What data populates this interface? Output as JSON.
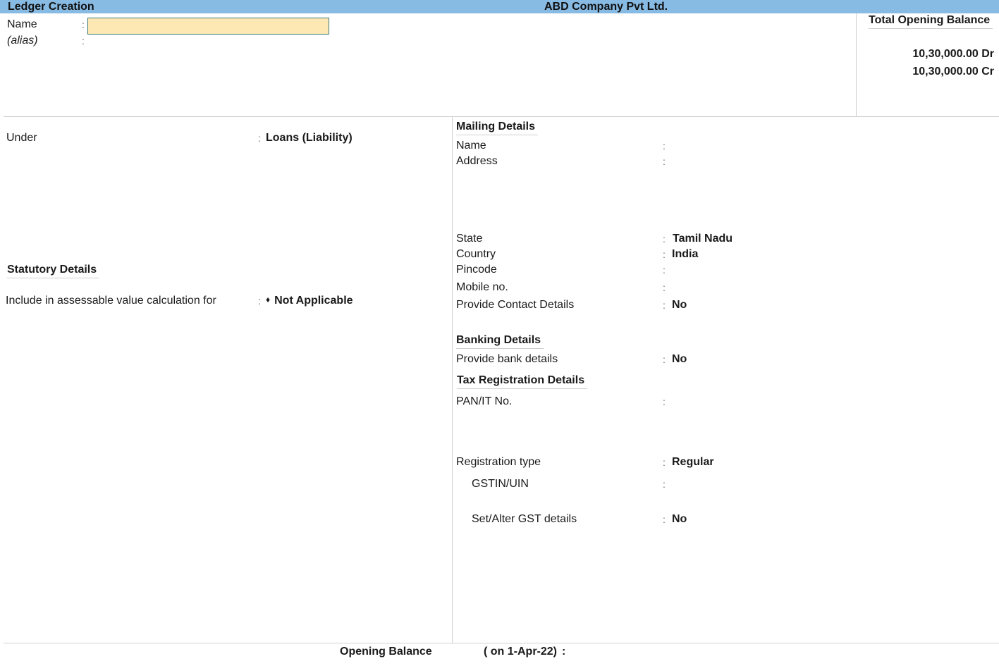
{
  "header": {
    "screen_title": "Ledger Creation",
    "company_name": "ABD Company Pvt Ltd."
  },
  "top": {
    "name_label": "Name",
    "name_value": "",
    "alias_label": "(alias)",
    "alias_value": ""
  },
  "total_opening_balance": {
    "title": "Total Opening Balance",
    "debit": "10,30,000.00 Dr",
    "credit": "10,30,000.00 Cr"
  },
  "left": {
    "under_label": "Under",
    "under_value": "Loans (Liability)",
    "statutory_heading": "Statutory Details",
    "assessable_label": "Include in assessable value calculation for",
    "assessable_value": "Not Applicable",
    "assessable_icon": "diamond-icon"
  },
  "mailing": {
    "heading": "Mailing Details",
    "fields": [
      {
        "label": "Name",
        "value": ""
      },
      {
        "label": "Address",
        "value": ""
      },
      {
        "label": "State",
        "value": "Tamil Nadu"
      },
      {
        "label": "Country",
        "value": "India"
      },
      {
        "label": "Pincode",
        "value": ""
      },
      {
        "label": "Mobile no.",
        "value": ""
      },
      {
        "label": "Provide Contact Details",
        "value": "No"
      }
    ]
  },
  "banking": {
    "heading": "Banking Details",
    "provide_label": "Provide bank details",
    "provide_value": "No"
  },
  "tax": {
    "heading": "Tax Registration Details",
    "pan_label": "PAN/IT No.",
    "pan_value": "",
    "reg_type_label": "Registration type",
    "reg_type_value": "Regular",
    "gstin_label": "GSTIN/UIN",
    "gstin_value": "",
    "gst_details_label": "Set/Alter GST details",
    "gst_details_value": "No"
  },
  "footer": {
    "opening_balance_label": "Opening Balance",
    "opening_balance_date": "( on 1-Apr-22)",
    "opening_balance_value": ""
  },
  "colon": ":"
}
